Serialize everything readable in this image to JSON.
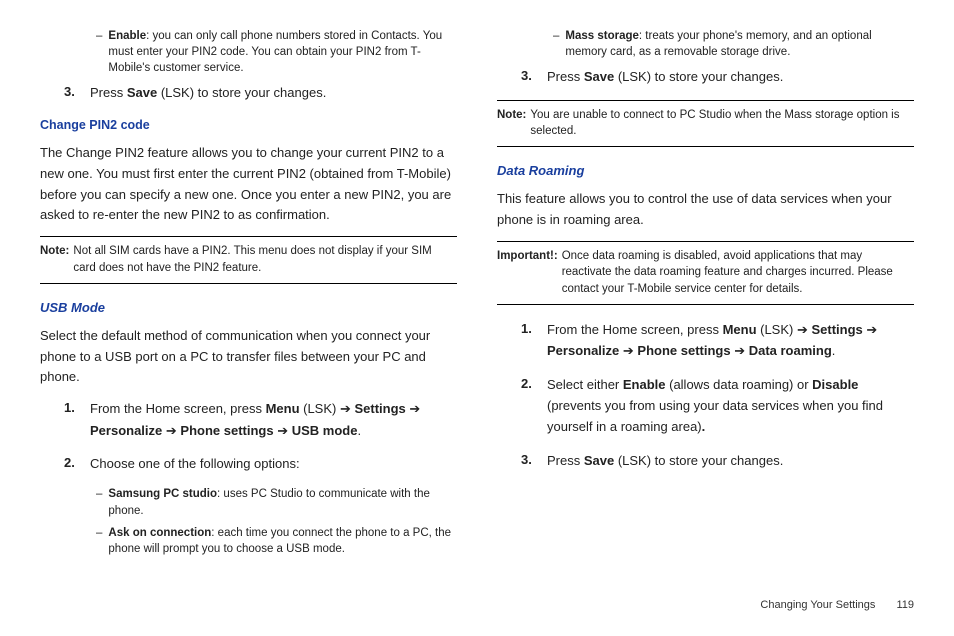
{
  "left": {
    "bullet1_bold": "Enable",
    "bullet1_rest": ": you can only call phone numbers stored in Contacts. You must enter your PIN2 code. You can obtain your PIN2 from T-Mobile's customer service.",
    "step3_pre": "Press ",
    "step3_bold": "Save",
    "step3_post": " (LSK) to store your changes.",
    "h_change": "Change PIN2 code",
    "change_para": "The Change PIN2 feature allows you to change your current PIN2 to a new one. You must first enter the current PIN2 (obtained from T-Mobile) before you can specify a new one. Once you enter a new PIN2, you are asked to re-enter the new PIN2 to as confirmation.",
    "note1_label": "Note:",
    "note1_text": " Not all SIM cards have a PIN2. This menu does not display if your SIM card does not have the PIN2 feature.",
    "h_usb": "USB Mode",
    "usb_para": "Select the default method of communication when you connect your phone to a USB port on a PC to transfer files between your PC and phone.",
    "usb_s1_pre": "From the Home screen, press ",
    "usb_s1_menu": "Menu",
    "usb_s1_lsk": " (LSK) ",
    "usb_s1_arrow": "➔",
    "usb_s1_settings": " Settings ",
    "usb_s1_personalize": "Personalize ",
    "usb_s1_phone": " Phone settings  ",
    "usb_s1_mode": " USB mode",
    "usb_s2": "Choose one of the following options:",
    "usb_b1_bold": "Samsung PC studio",
    "usb_b1_rest": ": uses PC Studio to communicate with the phone.",
    "usb_b2_bold": "Ask on connection",
    "usb_b2_rest": ": each time you connect the phone to a PC, the phone will prompt you to choose a USB mode."
  },
  "right": {
    "bullet_ms_bold": "Mass storage",
    "bullet_ms_rest": ": treats your phone's memory, and an optional memory card, as a removable storage drive.",
    "step3_pre": "Press ",
    "step3_bold": "Save",
    "step3_post": " (LSK) to store your changes.",
    "note2_label": "Note:",
    "note2_text": " You are unable to connect to PC Studio when the Mass storage option is selected.",
    "h_roaming": "Data Roaming",
    "roam_para": "This feature allows you to control the use of data services when your phone is in roaming area.",
    "imp_label": "Important!:",
    "imp_text": " Once data roaming is disabled, avoid applications that may reactivate the data roaming feature and charges incurred. Please contact your T-Mobile service center for details.",
    "r_s1_pre": "From the Home screen, press ",
    "r_s1_menu": "Menu",
    "r_s1_lsk": " (LSK) ",
    "arrow": "➔",
    "r_s1_settings": " Settings ",
    "r_s1_personalize": "Personalize ",
    "r_s1_phone": " Phone settings  ",
    "r_s1_roam": " Data roaming",
    "r_s2_a": "Select either ",
    "r_s2_enable": "Enable",
    "r_s2_b": " (allows data roaming) or ",
    "r_s2_disable": "Disable",
    "r_s2_c": " (prevents you from using your data services when you find yourself in a roaming area)",
    "r_s3_pre": "Press ",
    "r_s3_bold": "Save",
    "r_s3_post": " (LSK) to store your changes."
  },
  "footer": {
    "section": "Changing Your Settings",
    "page": "119"
  },
  "num3": "3.",
  "num1": "1.",
  "num2": "2.",
  "dash": "–",
  "period": "."
}
